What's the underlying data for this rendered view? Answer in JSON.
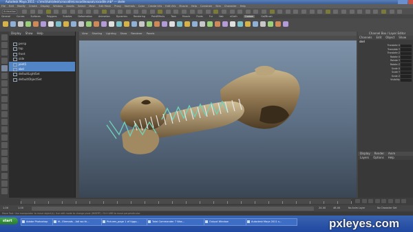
{
  "window": {
    "title": "Autodesk Maya 2011 - c:\\mrz\\tuts\\desk\\crocodile\\crocodileaaaa\\crocodile.mb* --- skele"
  },
  "menubar": {
    "items": [
      "File",
      "Edit",
      "Modify",
      "Create",
      "Display",
      "Window",
      "Assets",
      "Select",
      "Mesh",
      "Edit Mesh",
      "Proxy",
      "Normals",
      "Color",
      "Create UVs",
      "Edit UVs",
      "Muscle",
      "Help",
      "Constrain",
      "Skin",
      "Character",
      "Help"
    ]
  },
  "statusline": {
    "mode": "Animation"
  },
  "shelf": {
    "tabs": [
      "General",
      "Curves",
      "Surfaces",
      "Polygons",
      "Subdivs",
      "Deformation",
      "Animation",
      "Dynamics",
      "Rendering",
      "PaintEffects",
      "Toon",
      "Muscle",
      "Fluids",
      "Fur",
      "Hair",
      "nCloth",
      "Custom",
      "GoZBrush"
    ],
    "active_tab": "Custom"
  },
  "outliner": {
    "menu": [
      "Display",
      "Show",
      "Help"
    ],
    "items": [
      {
        "name": "persp",
        "selected": false
      },
      {
        "name": "top",
        "selected": false
      },
      {
        "name": "front",
        "selected": false
      },
      {
        "name": "side",
        "selected": false
      },
      {
        "name": "joint1",
        "selected": true
      },
      {
        "name": "skel",
        "selected": true
      },
      {
        "name": "defaultLightSet",
        "selected": false
      },
      {
        "name": "defaultObjectSet",
        "selected": false
      }
    ]
  },
  "viewport": {
    "menu": [
      "View",
      "Shading",
      "Lighting",
      "Show",
      "Renderer",
      "Panels"
    ],
    "label": "persp"
  },
  "channel_box": {
    "title": "Channel Box / Layer Editor",
    "menu": [
      "Channels",
      "Edit",
      "Object",
      "Show"
    ],
    "object": "skel",
    "attributes": [
      "Translate X",
      "Translate Y",
      "Translate Z",
      "Rotate X",
      "Rotate Y",
      "Rotate Z",
      "Scale X",
      "Scale Y",
      "Scale Z",
      "Visibility"
    ],
    "layers_menu": [
      "Display",
      "Render",
      "Anim"
    ],
    "layers_sub": [
      "Layers",
      "Options",
      "Help"
    ]
  },
  "timeline": {
    "start": "1.00",
    "end": "24.00",
    "range_start": "1.00",
    "range_end": "24.00",
    "range_end2": "48.00",
    "current": "1.00",
    "character": "No Character Set",
    "anim_layer": "No Anim Layer"
  },
  "command_line": {
    "text": "Move Tool: Use manipulator to move object(s). Use edit mode to change pivot (INSERT). Ctrl+LMB to move perpendicular."
  },
  "taskbar": {
    "start_label": "start",
    "items": [
      "Adobe Photoshop",
      "M...Elemads - Adl wo th...",
      "Pictures_page 1 of Vggo...",
      "Total Commander 7 Was...",
      "Output Window",
      "Autodesk Maya 2011 s..."
    ]
  },
  "watermark": "pxleyes.com",
  "colors": {
    "selection": "#5285c6",
    "taskbar": "#2452a8",
    "viewport_top": "#8196ad",
    "viewport_bottom": "#3a4654"
  }
}
